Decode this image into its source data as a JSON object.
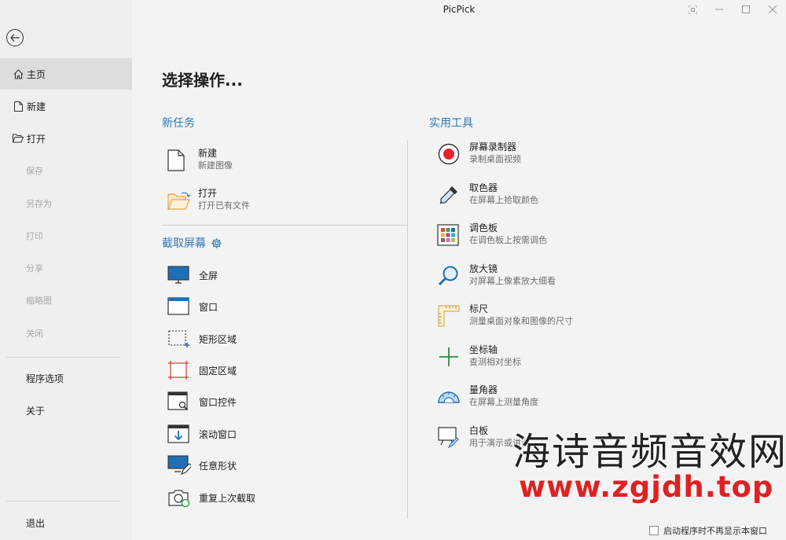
{
  "window": {
    "title": "PicPick",
    "controls": [
      "capture-icon",
      "minimize-icon",
      "maximize-icon",
      "close-icon"
    ]
  },
  "sidebar": {
    "back_icon": "back-arrow-icon",
    "items": [
      {
        "label": "主页",
        "icon": "home-icon",
        "active": true
      },
      {
        "label": "新建",
        "icon": "new-file-icon"
      },
      {
        "label": "打开",
        "icon": "open-folder-icon"
      },
      {
        "label": "保存",
        "disabled": true
      },
      {
        "label": "另存为",
        "disabled": true
      },
      {
        "label": "打印",
        "disabled": true
      },
      {
        "label": "分享",
        "disabled": true
      },
      {
        "label": "缩略图",
        "disabled": true
      },
      {
        "label": "关闭",
        "disabled": true
      },
      {
        "label": "程序选项"
      },
      {
        "label": "关于"
      },
      {
        "label": "退出"
      }
    ]
  },
  "main": {
    "title": "选择操作...",
    "new_task": {
      "heading": "新任务",
      "items": [
        {
          "title": "新建",
          "subtitle": "新建图像",
          "icon": "new-image-icon"
        },
        {
          "title": "打开",
          "subtitle": "打开已有文件",
          "icon": "open-folder-icon"
        }
      ]
    },
    "capture": {
      "heading": "截取屏幕",
      "settings_icon": "gear-icon",
      "items": [
        {
          "label": "全屏",
          "icon": "fullscreen-icon"
        },
        {
          "label": "窗口",
          "icon": "window-icon"
        },
        {
          "label": "矩形区域",
          "icon": "rect-region-icon"
        },
        {
          "label": "固定区域",
          "icon": "fixed-region-icon"
        },
        {
          "label": "窗口控件",
          "icon": "window-control-icon"
        },
        {
          "label": "滚动窗口",
          "icon": "scroll-window-icon"
        },
        {
          "label": "任意形状",
          "icon": "freehand-icon"
        },
        {
          "label": "重复上次截取",
          "icon": "repeat-capture-icon"
        }
      ]
    },
    "tools": {
      "heading": "实用工具",
      "items": [
        {
          "title": "屏幕录制器",
          "subtitle": "录制桌面视频",
          "icon": "record-icon"
        },
        {
          "title": "取色器",
          "subtitle": "在屏幕上拾取颜色",
          "icon": "eyedropper-icon"
        },
        {
          "title": "调色板",
          "subtitle": "在调色板上按需调色",
          "icon": "palette-icon"
        },
        {
          "title": "放大镜",
          "subtitle": "对屏幕上像素放大细看",
          "icon": "magnifier-icon"
        },
        {
          "title": "标尺",
          "subtitle": "测量桌面对象和图像的尺寸",
          "icon": "ruler-icon"
        },
        {
          "title": "坐标轴",
          "subtitle": "查测相对坐标",
          "icon": "crosshair-icon"
        },
        {
          "title": "量角器",
          "subtitle": "在屏幕上测量角度",
          "icon": "protractor-icon"
        },
        {
          "title": "白板",
          "subtitle": "用于演示或讲课",
          "icon": "whiteboard-icon"
        }
      ]
    }
  },
  "footer": {
    "checkbox_label": "启动程序时不再显示本窗口",
    "checked": false
  },
  "watermark": {
    "line1": "海诗音频音效网",
    "line2": "www.zgjdh.top"
  },
  "colors": {
    "accent": "#2f79b6",
    "active_bg": "#dcdcdc",
    "watermark_red": "#e02121"
  }
}
